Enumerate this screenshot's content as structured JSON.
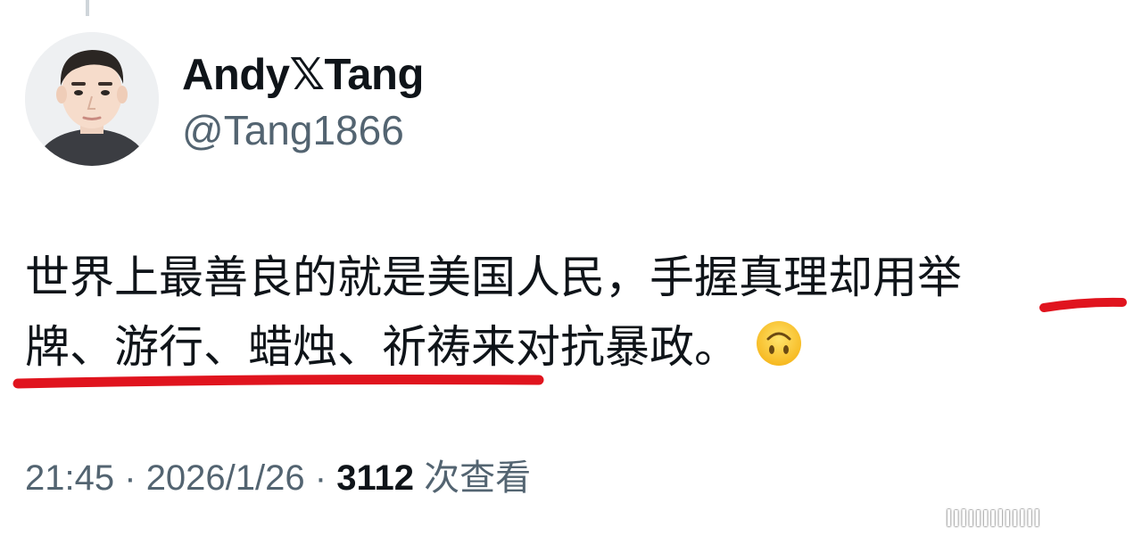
{
  "tweet": {
    "display_name": "Andy𝕏Tang",
    "handle": "@Tang1866",
    "text_line1": "世界上最善良的就是美国人民，手握真理却用举",
    "text_line2": "牌、游行、蜡烛、祈祷来对抗暴政。",
    "time": "21:45",
    "separator": "·",
    "date": "2026/1/26",
    "views_count": "3112",
    "views_label": "次查看"
  },
  "icons": {
    "avatar": "person-avatar-icon",
    "emoji": "upside-down-face-icon"
  },
  "annotations": {
    "underline_color": "#e0141e"
  },
  "watermark": {
    "text": "lIlIIIIlIIlll"
  }
}
